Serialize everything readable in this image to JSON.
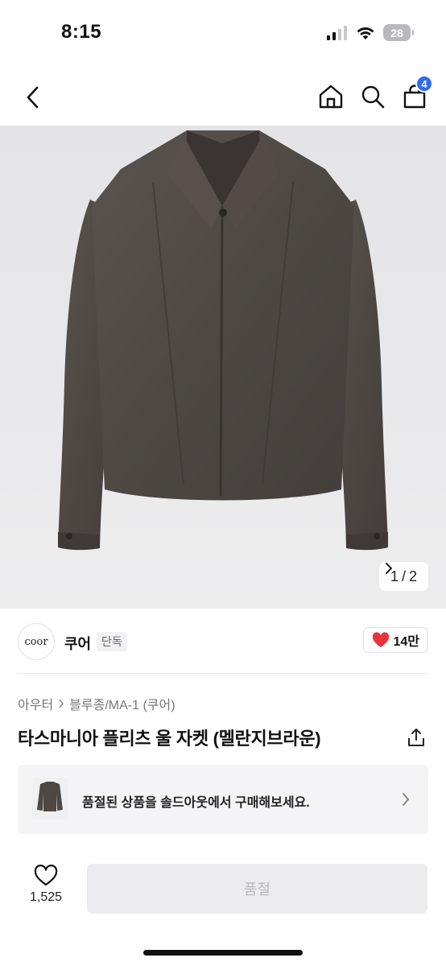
{
  "status_bar": {
    "time": "8:15",
    "battery": "28",
    "icons": [
      "cellular-signal-icon",
      "wifi-icon",
      "battery-icon"
    ]
  },
  "nav": {
    "icons": [
      "back-chevron-icon",
      "home-icon",
      "search-icon",
      "cart-icon"
    ],
    "cart_badge": "4",
    "badge_color": "#2e6bf0"
  },
  "gallery": {
    "current": "1",
    "separator": "/",
    "total": "2"
  },
  "brand": {
    "logo_text": "coor",
    "name": "쿠어",
    "tag": "단독",
    "like_count": "14만",
    "heart_color": "#e8333a"
  },
  "product": {
    "breadcrumb": [
      "아우터",
      "블루종/MA-1 (쿠어)"
    ],
    "title": "타스마니아 플리츠 울 자켓 (멜란지브라운)"
  },
  "soldout_banner": {
    "text": "품절된 상품을 솔드아웃에서 구매해보세요."
  },
  "bottom_bar": {
    "wish_count": "1,525",
    "buy_label": "품절"
  }
}
